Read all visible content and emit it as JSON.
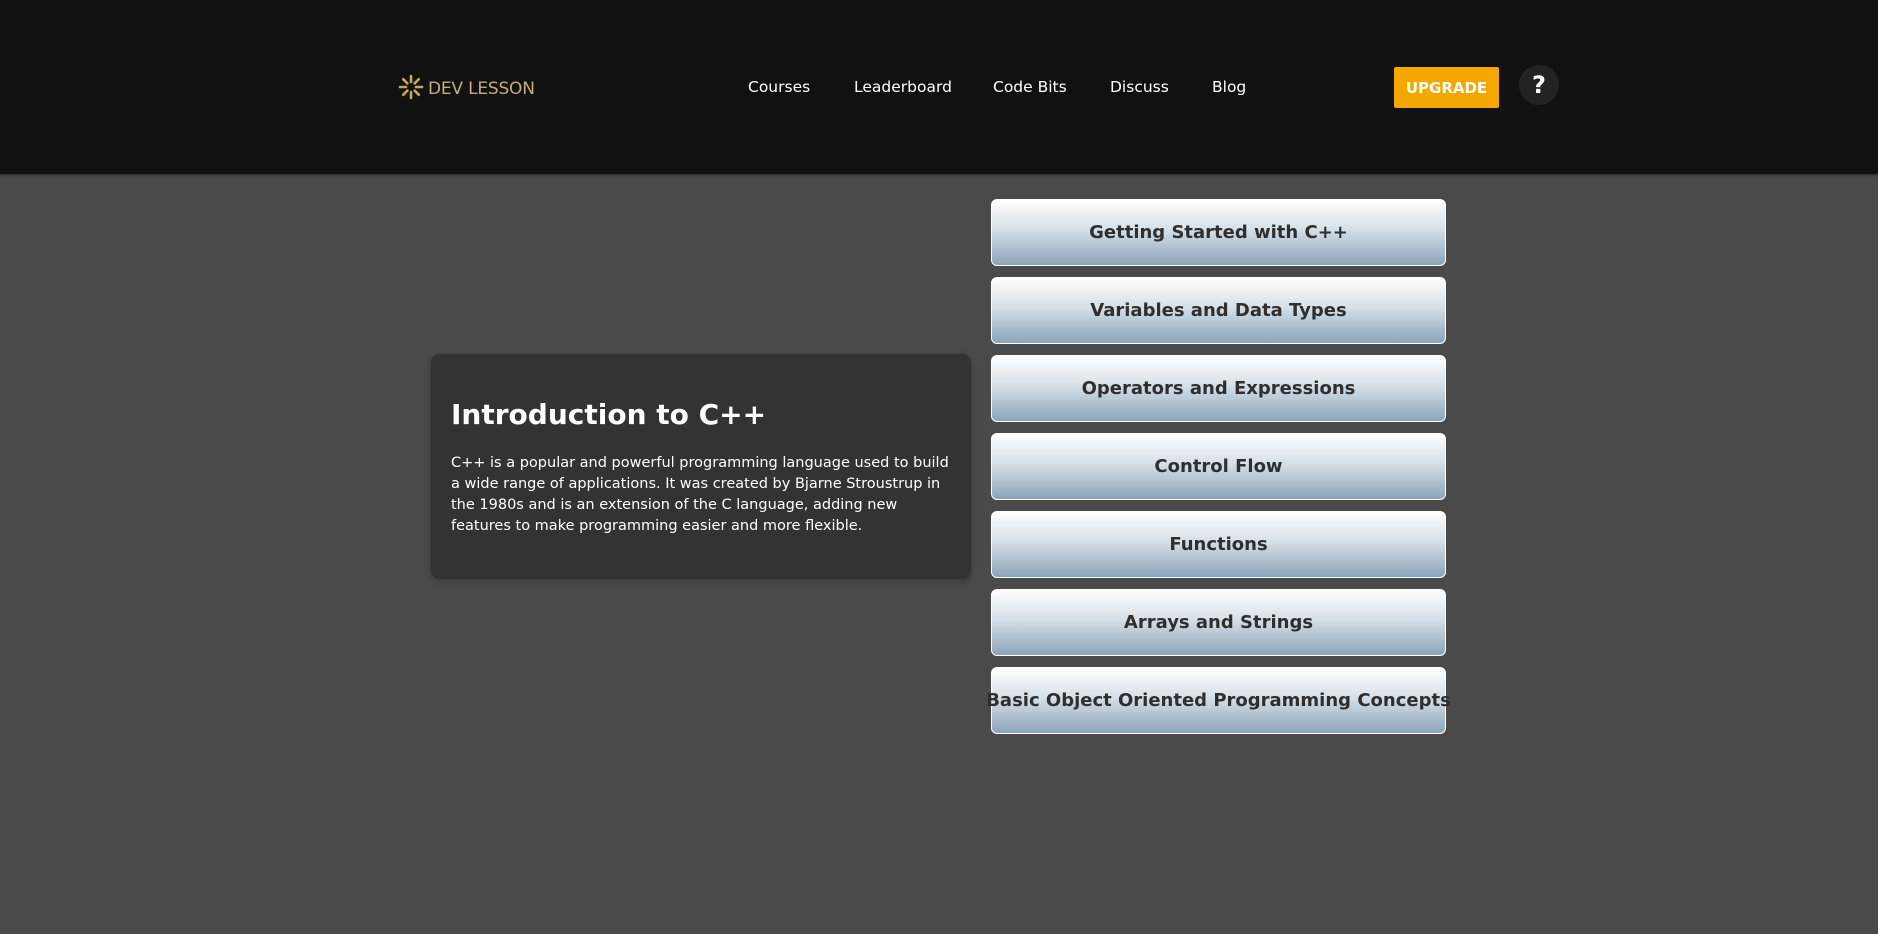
{
  "header": {
    "logo_text": "DEV LESSON",
    "logo_icon": "sunburst-logo-icon",
    "nav_items": [
      {
        "label": "Courses"
      },
      {
        "label": "Leaderboard"
      },
      {
        "label": "Code Bits"
      },
      {
        "label": "Discuss"
      },
      {
        "label": "Blog"
      }
    ],
    "upgrade_label": "UPGRADE",
    "help_label": "?",
    "help_icon": "question-mark-icon"
  },
  "intro": {
    "title": "Introduction to C++",
    "text": "C++ is a popular and powerful programming language used to build a wide range of applications. It was created by Bjarne Stroustrup in the 1980s and is an extension of the C language, adding new features to make programming easier and more flexible."
  },
  "lessons": [
    {
      "label": "Getting Started with C++"
    },
    {
      "label": "Variables and Data Types"
    },
    {
      "label": "Operators and Expressions"
    },
    {
      "label": "Control Flow"
    },
    {
      "label": "Functions"
    },
    {
      "label": "Arrays and Strings"
    },
    {
      "label": "Basic Object Oriented Programming Concepts"
    }
  ],
  "colors": {
    "header_bg": "#111111",
    "page_bg": "#4a4a4a",
    "card_bg": "#333333",
    "accent": "#f5a700",
    "logo": "#c2ad7c"
  }
}
